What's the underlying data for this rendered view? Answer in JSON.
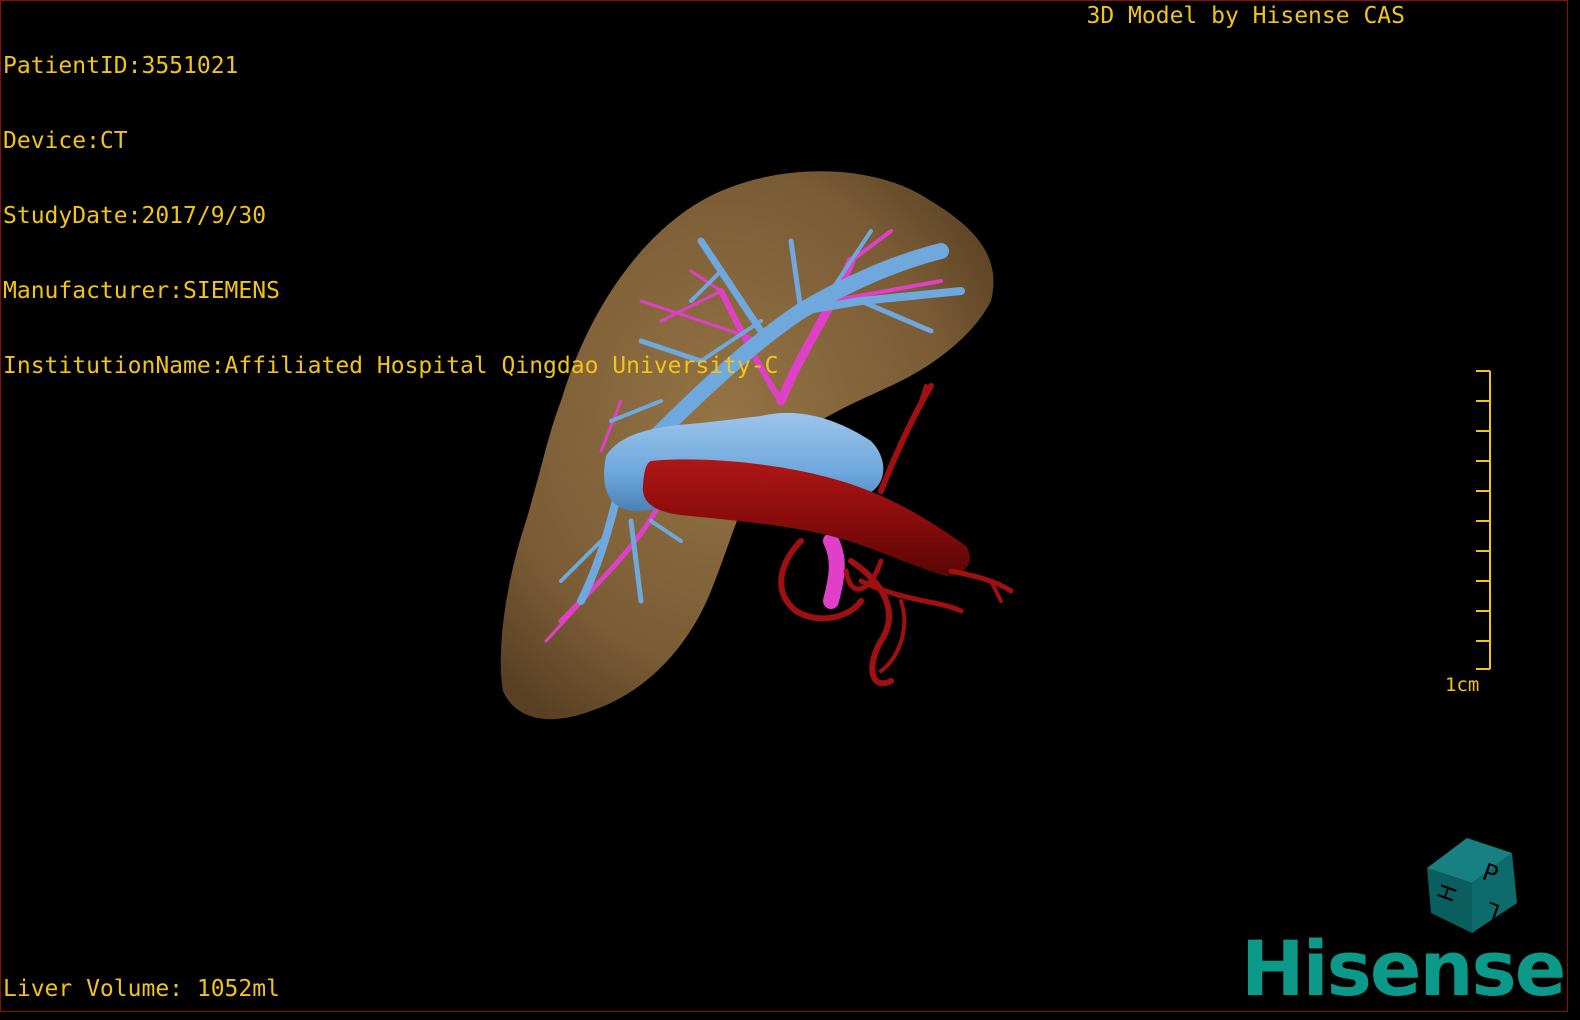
{
  "header": {
    "patient_id": "PatientID:3551021",
    "device": "Device:CT",
    "study_date": "StudyDate:2017/9/30",
    "manufacturer": "Manufacturer:SIEMENS",
    "institution": "InstitutionName:Affiliated Hospital Qingdao University-C"
  },
  "credit": "3D Model by Hisense CAS",
  "scale": {
    "label": "1cm",
    "color": "#f0c419"
  },
  "volume": "Liver Volume: 1052ml",
  "orientation_cube": {
    "faces": [
      "P",
      "H",
      "L"
    ],
    "color": "#0e6b6b"
  },
  "brand": {
    "name": "Hisense",
    "color": "#0b9a8a"
  },
  "colors": {
    "liver": "#8b6a3e",
    "portal_vein": "#6fa8dc",
    "hepatic_artery": "#e040c8",
    "aorta": "#8b0c0c",
    "text": "#f0c419",
    "border": "#8a1010"
  }
}
